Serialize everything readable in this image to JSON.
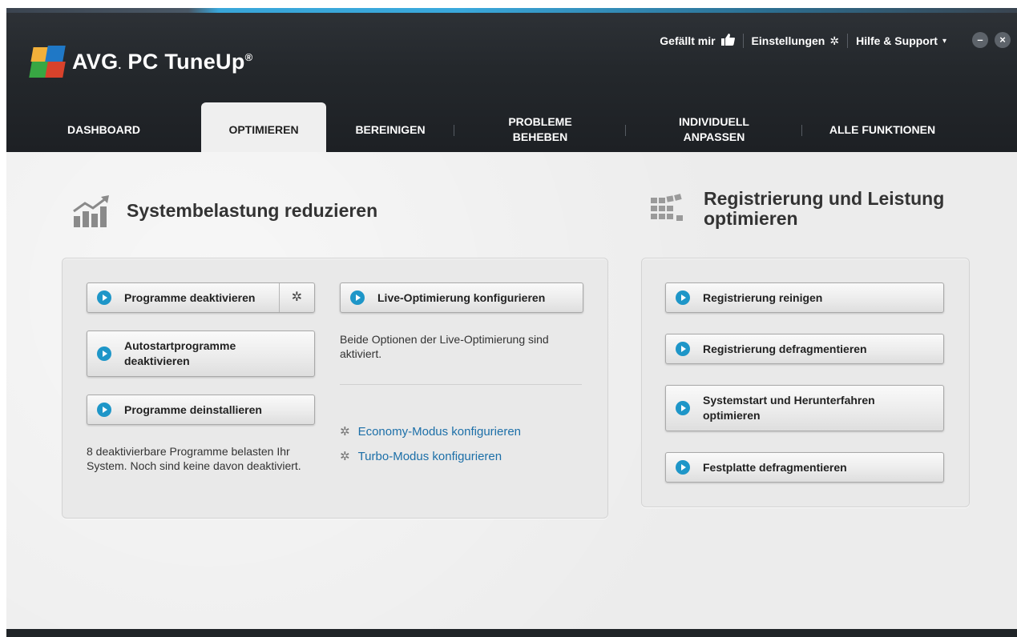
{
  "app": {
    "brand": "AVG",
    "product": "PC TuneUp",
    "registered_mark": "®"
  },
  "header": {
    "like_label": "Gefällt mir",
    "like_icon": "thumbs-up-icon",
    "settings_label": "Einstellungen",
    "settings_icon": "gear-icon",
    "help_label": "Hilfe & Support",
    "help_arrow": "▾",
    "minimize": "–",
    "close": "×"
  },
  "tabs": [
    {
      "label": "DASHBOARD",
      "active": false
    },
    {
      "label": "OPTIMIEREN",
      "active": true
    },
    {
      "label": "BEREINIGEN",
      "active": false
    },
    {
      "label": "PROBLEME\nBEHEBEN",
      "active": false
    },
    {
      "label": "INDIVIDUELL\nANPASSEN",
      "active": false
    },
    {
      "label": "ALLE FUNKTIONEN",
      "active": false
    }
  ],
  "left_section": {
    "title": "Systembelastung reduzieren",
    "buttons": {
      "deactivate": "Programme deaktivieren",
      "autostart": "Autostartprogramme\ndeaktivieren",
      "uninstall": "Programme deinstallieren",
      "live": "Live-Optimierung konfigurieren"
    },
    "programs_desc": "8 deaktivierbare Programme belasten Ihr System. Noch sind keine davon deaktiviert.",
    "live_desc": "Beide Optionen der Live-Optimierung sind aktiviert.",
    "links": {
      "economy": "Economy-Modus konfigurieren",
      "turbo": "Turbo-Modus konfigurieren"
    }
  },
  "right_section": {
    "title": "Registrierung und Leistung\noptimieren",
    "buttons": {
      "clean": "Registrierung reinigen",
      "defrag_registry": "Registrierung defragmentieren",
      "startup": "Systemstart und Herunterfahren\noptimieren",
      "defrag_disk": "Festplatte defragmentieren"
    }
  },
  "colors": {
    "header_bg": "#24282c",
    "accent": "#1e96c8",
    "link": "#1c6fa8",
    "content_bg": "#ececec"
  }
}
